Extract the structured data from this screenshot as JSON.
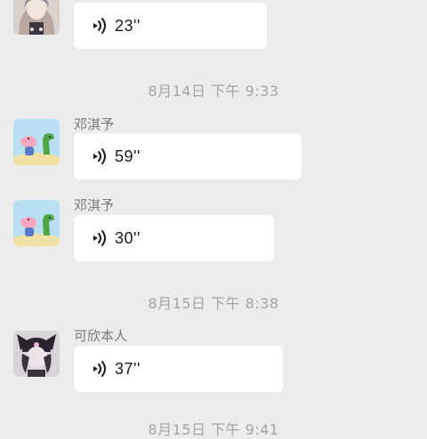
{
  "messages": [
    {
      "sender": "",
      "duration": "23''",
      "avatar": "girl-avatar"
    },
    {
      "sender": "邓淇予",
      "duration": "59''",
      "avatar": "peppa-pig-avatar"
    },
    {
      "sender": "邓淇予",
      "duration": "30''",
      "avatar": "peppa-pig-avatar"
    },
    {
      "sender": "可欣本人",
      "duration": "37''",
      "avatar": "kuromi-girl-avatar"
    }
  ],
  "timestamps": [
    "8月14日 下午 9:33",
    "8月15日 下午 8:38",
    "8月15日 下午 9:41"
  ],
  "icons": {
    "voice": "voice-wave-icon"
  },
  "colors": {
    "background": "#ececec",
    "bubble": "#ffffff",
    "timestamp": "#a4a4a4"
  }
}
